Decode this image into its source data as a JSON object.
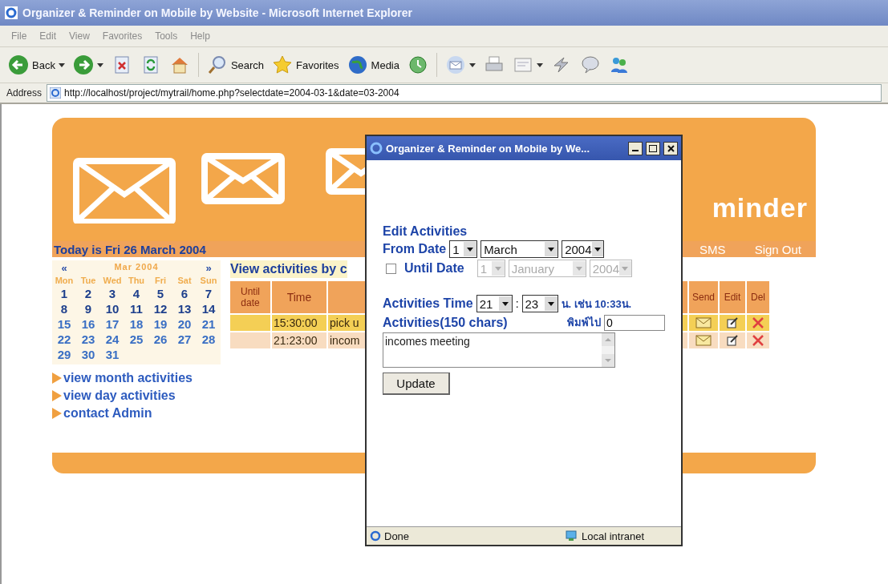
{
  "window": {
    "title": "Organizer & Reminder on Mobile by Website - Microsoft Internet Explorer"
  },
  "menu": [
    "File",
    "Edit",
    "View",
    "Favorites",
    "Tools",
    "Help"
  ],
  "toolbar": [
    {
      "kind": "back",
      "label": "Back",
      "dropdown": true
    },
    {
      "kind": "forward",
      "dropdown": true
    },
    {
      "kind": "stop"
    },
    {
      "kind": "refresh"
    },
    {
      "kind": "home"
    },
    {
      "kind": "separator"
    },
    {
      "kind": "search",
      "label": "Search"
    },
    {
      "kind": "favorites",
      "label": "Favorites"
    },
    {
      "kind": "media",
      "label": "Media"
    },
    {
      "kind": "history"
    },
    {
      "kind": "separator"
    },
    {
      "kind": "mail",
      "dropdown": true
    },
    {
      "kind": "print"
    },
    {
      "kind": "edit",
      "dropdown": true
    },
    {
      "kind": "discuss"
    },
    {
      "kind": "messenger"
    },
    {
      "kind": "people"
    }
  ],
  "address": {
    "label": "Address",
    "url": "http://localhost/project/mytrail/home.php?selectdate=2004-03-1&date=03-2004"
  },
  "page": {
    "banner_title": "minder",
    "today": "Today is Fri 26 March 2004",
    "nav": [
      "SMS",
      "Sign Out"
    ],
    "calendar": {
      "prev": "«",
      "month": "Mar 2004",
      "next": "»",
      "weekdays": [
        "Mon",
        "Tue",
        "Wed",
        "Thu",
        "Fri",
        "Sat",
        "Sun"
      ],
      "weeks": [
        [
          "1",
          "2",
          "3",
          "4",
          "5",
          "6",
          "7"
        ],
        [
          "8",
          "9",
          "10",
          "11",
          "12",
          "13",
          "14"
        ],
        [
          "15",
          "16",
          "17",
          "18",
          "19",
          "20",
          "21"
        ],
        [
          "22",
          "23",
          "24",
          "25",
          "26",
          "27",
          "28"
        ],
        [
          "29",
          "30",
          "31"
        ]
      ]
    },
    "links": [
      "view month activities",
      "view day activities",
      "contact Admin"
    ],
    "activities": {
      "title": "View activities by c",
      "columns": [
        "Until date",
        "Time"
      ],
      "action_columns": [
        "Send",
        "Edit",
        "Del"
      ],
      "rows": [
        {
          "until": "",
          "time": "15:30:00",
          "text": "pick u",
          "color": "#f4cf55"
        },
        {
          "until": "",
          "time": "21:23:00",
          "text": "incom",
          "color": "#f8dcc0"
        }
      ]
    }
  },
  "popup": {
    "title": "Organizer & Reminder on Mobile by We...",
    "heading": "Edit Activities",
    "from_label": "From Date",
    "from": [
      {
        "value": "1",
        "disabled": false
      },
      {
        "value": "March",
        "disabled": false
      },
      {
        "value": "2004",
        "disabled": false
      }
    ],
    "until_checked": false,
    "until_label": "Until Date",
    "until": [
      {
        "value": "1",
        "disabled": true
      },
      {
        "value": "January",
        "disabled": true
      },
      {
        "value": "2004",
        "disabled": true
      }
    ],
    "time_label": "Activities Time",
    "hour": "21",
    "separator": ":",
    "minute": "23",
    "time_hint": "น. เช่น 10:33น.",
    "activities_label": "Activities(150 chars)",
    "count_label": "พิมพ์ไป",
    "count": "0",
    "text": "incomes meeting",
    "button": "Update",
    "status": "Done",
    "zone": "Local intranet"
  }
}
